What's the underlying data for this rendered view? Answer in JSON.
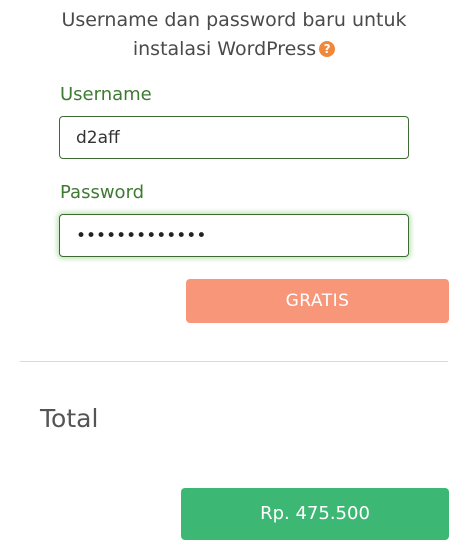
{
  "intro": {
    "line1": "Username dan password baru untuk",
    "line2": "instalasi WordPress",
    "help_icon": "question-icon",
    "help_glyph": "?"
  },
  "form": {
    "username_label": "Username",
    "username_value": "d2aff",
    "password_label": "Password",
    "password_value": "•••••••••••••"
  },
  "buttons": {
    "gratis_label": "GRATIS",
    "price_label": "Rp. 475.500"
  },
  "summary": {
    "total_label": "Total"
  },
  "colors": {
    "label_green": "#3e7a33",
    "gratis_button": "#f8967a",
    "price_button": "#3db874",
    "help_icon": "#f0883c"
  }
}
